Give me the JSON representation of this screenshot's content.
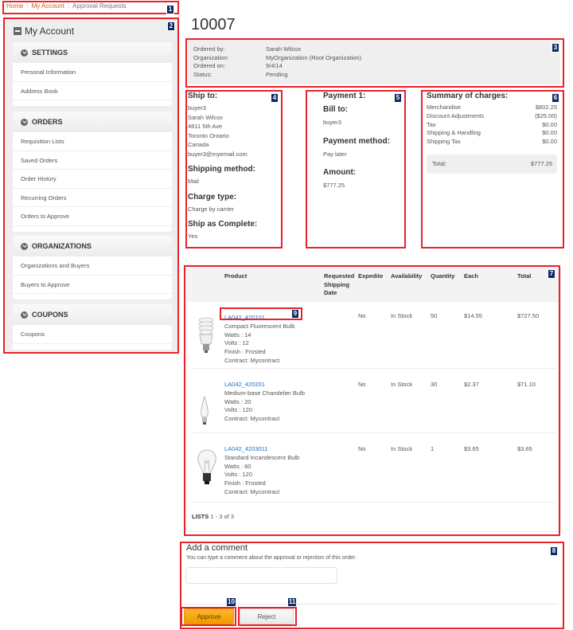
{
  "breadcrumb": {
    "items": [
      {
        "label": "Home"
      },
      {
        "label": "My Account"
      },
      {
        "label": "Approval Requests"
      }
    ]
  },
  "sidebar": {
    "title": "My Account",
    "groups": [
      {
        "title": "SETTINGS",
        "items": [
          "Personal Information",
          "Address Book"
        ]
      },
      {
        "title": "ORDERS",
        "items": [
          "Requisition Lists",
          "Saved Orders",
          "Order History",
          "Recurring Orders",
          "Orders to Approve"
        ]
      },
      {
        "title": "ORGANIZATIONS",
        "items": [
          "Organizations and Buyers",
          "Buyers to Approve"
        ]
      },
      {
        "title": "COUPONS",
        "items": [
          "Coupons"
        ]
      }
    ]
  },
  "order": {
    "id": "10007",
    "info": [
      {
        "label": "Ordered by:",
        "value": "Sarah Wilcox"
      },
      {
        "label": "Organization:",
        "value": "MyOrganization (Root Organization)"
      },
      {
        "label": "Ordered on:",
        "value": "9/4/14"
      },
      {
        "label": "Status:",
        "value": "Pending"
      }
    ]
  },
  "shipping": {
    "ship_to_heading": "Ship to:",
    "address_lines": [
      "buyer3",
      "Sarah Wilcox",
      "4811 5th Ave",
      "Toronto Ontario",
      "Canada",
      "buyer3@myemail.com"
    ],
    "method_heading": "Shipping method:",
    "method": "Mail",
    "charge_heading": "Charge type:",
    "charge": "Charge by carrier",
    "complete_heading": "Ship as Complete:",
    "complete": "Yes"
  },
  "payment": {
    "heading": "Payment 1:",
    "bill_to_heading": "Bill to:",
    "bill_to": "buyer3",
    "method_heading": "Payment method:",
    "method": "Pay later",
    "amount_heading": "Amount:",
    "amount": "$777.25"
  },
  "summary": {
    "heading": "Summary of charges:",
    "rows": [
      {
        "label": "Merchandise",
        "value": "$802.25"
      },
      {
        "label": "Discount Adjustments",
        "value": "($25.00)"
      },
      {
        "label": "Tax",
        "value": "$0.00"
      },
      {
        "label": "Shipping & Handling",
        "value": "$0.00"
      },
      {
        "label": "Shipping Tax",
        "value": "$0.00"
      }
    ],
    "total_label": "Total:",
    "total_value": "$777.25"
  },
  "items": {
    "columns": {
      "product": "Product",
      "requested_ship_1": "Requested",
      "requested_ship_2": "Shipping",
      "requested_ship_3": "Date",
      "expedite": "Expedite",
      "availability": "Availability",
      "quantity": "Quantity",
      "each": "Each",
      "total": "Total"
    },
    "rows": [
      {
        "sku": "LA042_420101",
        "name": "Compact Fluorescent Bulb",
        "attrs": [
          "Watts : 14",
          "Volts : 12",
          "Finish : Frosted",
          "Contract: Mycontract"
        ],
        "expedite": "No",
        "availability": "In Stock",
        "quantity": "50",
        "each": "$14.55",
        "total": "$727.50",
        "image": "cfl-bulb"
      },
      {
        "sku": "LA042_420201",
        "name": "Medium-base Chandelier Bulb",
        "attrs": [
          "Watts : 20",
          "Volts : 120",
          "Contract: Mycontract"
        ],
        "expedite": "No",
        "availability": "In Stock",
        "quantity": "30",
        "each": "$2.37",
        "total": "$71.10",
        "image": "chandelier-bulb"
      },
      {
        "sku": "LA042_4203011",
        "name": "Standard Incandescent Bulb",
        "attrs": [
          "Watts : 60",
          "Volts : 120",
          "Finish : Frosted",
          "Contract: Mycontract"
        ],
        "expedite": "No",
        "availability": "In Stock",
        "quantity": "1",
        "each": "$3.65",
        "total": "$3.65",
        "image": "incandescent-bulb"
      }
    ],
    "footer_label": "LISTS",
    "footer_range": "1 - 3 of 3"
  },
  "comment": {
    "title": "Add a comment",
    "hint": "You can type a comment about the approval or rejection of this order.",
    "value": "",
    "placeholder": ""
  },
  "actions": {
    "approve": "Approve",
    "reject": "Reject"
  },
  "callouts": [
    "1",
    "2",
    "3",
    "4",
    "5",
    "6",
    "7",
    "8",
    "9",
    "10",
    "11"
  ]
}
